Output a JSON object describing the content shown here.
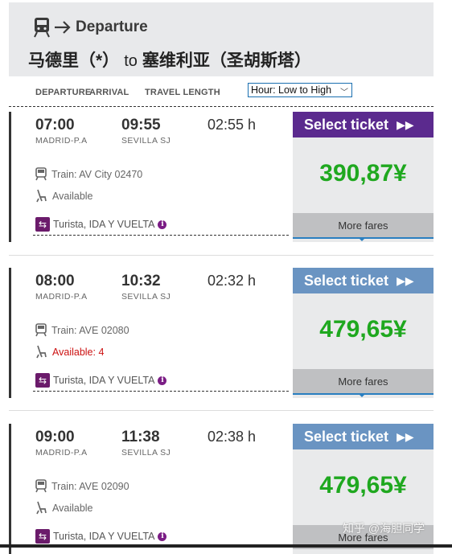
{
  "header": {
    "direction_label": "Departure",
    "origin": "马德里（*）",
    "to_word": "to",
    "destination": "塞维利亚（圣胡斯塔）"
  },
  "sortbar": {
    "col_departure": "DEPARTURE",
    "col_arrival": "ARRIVAL",
    "col_travel_length": "TRAVEL LENGTH",
    "sort_selected": "Hour: Low to High"
  },
  "trips": [
    {
      "dep_time": "07:00",
      "dep_station": "MADRID-P.A",
      "arr_time": "09:55",
      "arr_station": "SEVILLA SJ",
      "duration": "02:55 h",
      "train": "Train: AV City 02470",
      "availability": "Available",
      "fare": "Turista, IDA Y VUELTA",
      "select_label": "Select ticket",
      "price": "390,87¥",
      "more_label": "More fares",
      "button_color": "#5b2a8e"
    },
    {
      "dep_time": "08:00",
      "dep_station": "MADRID-P.A",
      "arr_time": "10:32",
      "arr_station": "SEVILLA SJ",
      "duration": "02:32 h",
      "train": "Train: AVE 02080",
      "availability": "Available: 4",
      "fare": "Turista, IDA Y VUELTA",
      "select_label": "Select ticket",
      "price": "479,65¥",
      "more_label": "More fares",
      "button_color": "#6a94c2"
    },
    {
      "dep_time": "09:00",
      "dep_station": "MADRID-P.A",
      "arr_time": "11:38",
      "arr_station": "SEVILLA SJ",
      "duration": "02:38 h",
      "train": "Train: AVE 02090",
      "availability": "Available",
      "fare": "Turista, IDA Y VUELTA",
      "select_label": "Select ticket",
      "price": "479,65¥",
      "more_label": "More fares",
      "button_color": "#6a94c2"
    }
  ],
  "watermark": "知乎 @海胆同学",
  "icons": {
    "header": "train-icon",
    "arrow": "right-arrow-icon",
    "train": "train-small-icon",
    "seat": "seat-icon",
    "fare": "swap-icon",
    "info": "info-icon",
    "select": "double-chevron-icon"
  },
  "colors": {
    "price": "#1fa81f",
    "warning": "#cc1111",
    "fare_icon": "#6b1b6b"
  }
}
